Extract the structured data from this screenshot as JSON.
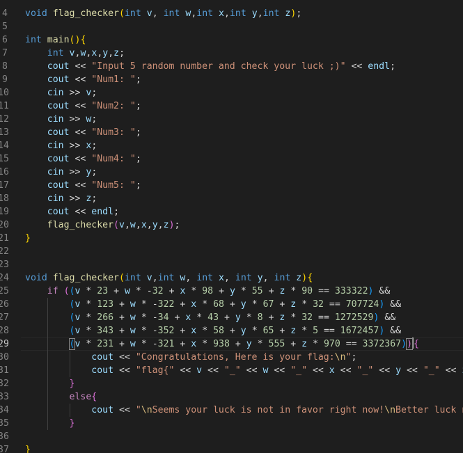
{
  "editor": {
    "language": "cpp",
    "first_line_number": 4,
    "active_line": 29,
    "lines": [
      "void flag_checker(int v, int w,int x,int y,int z);",
      "",
      "int main(){",
      "    int v,w,x,y,z;",
      "    cout << \"Input 5 random number and check your luck ;)\" << endl;",
      "    cout << \"Num1: \";",
      "    cin >> v;",
      "    cout << \"Num2: \";",
      "    cin >> w;",
      "    cout << \"Num3: \";",
      "    cin >> x;",
      "    cout << \"Num4: \";",
      "    cin >> y;",
      "    cout << \"Num5: \";",
      "    cin >> z;",
      "    cout << endl;",
      "    flag_checker(v,w,x,y,z);",
      "}",
      "",
      "",
      "void flag_checker(int v,int w, int x, int y, int z){",
      "    if ((v * 23 + w * -32 + x * 98 + y * 55 + z * 90 == 333322) &&",
      "        (v * 123 + w * -322 + x * 68 + y * 67 + z * 32 == 707724) &&",
      "        (v * 266 + w * -34 + x * 43 + y * 8 + z * 32 == 1272529) &&",
      "        (v * 343 + w * -352 + x * 58 + y * 65 + z * 5 == 1672457) &&",
      "        (v * 231 + w * -321 + x * 938 + y * 555 + z * 970 == 3372367)){",
      "            cout << \"Congratulations, Here is your flag:\\n\";",
      "            cout << \"flag{\" << v << \"_\" << w << \"_\" << x << \"_\" << y << \"_\" << z",
      "        }",
      "        else{",
      "            cout << \"\\nSeems your luck is not in favor right now!\\nBetter luck n",
      "        }",
      "",
      "}"
    ]
  },
  "colors": {
    "background": "#1e1e1e",
    "keyword": "#569cd6",
    "control": "#c586c0",
    "function": "#dcdcaa",
    "variable": "#9cdcfe",
    "string": "#ce9178",
    "number": "#b5cea8",
    "bracket_1": "#ffd700",
    "bracket_2": "#da70d6",
    "bracket_3": "#179fff"
  }
}
